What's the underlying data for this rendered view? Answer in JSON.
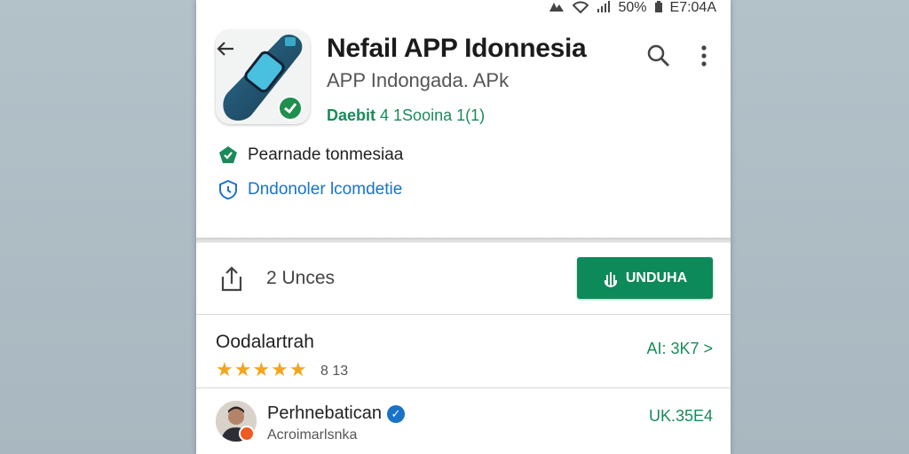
{
  "status_bar": {
    "battery": "50%",
    "time": "E7:04A"
  },
  "app": {
    "title": "Nefail APP Idonnesia",
    "subtitle": "APP Indongada. APk",
    "developer_name": "Daebit",
    "developer_rating": "4 1Sooina 1(1)"
  },
  "info": {
    "line1": "Pearnade tonmesiaa",
    "line2": "Dndonoler lcomdetie"
  },
  "install_row": {
    "units": "2 Unces",
    "install_label": "UNDUHA"
  },
  "rating_row": {
    "title": "Oodalartrah",
    "stars": "★★★★★",
    "count": "8 13",
    "value": "AI: 3K7 >"
  },
  "reviewer_row": {
    "name": "Perhnebatican",
    "sub": "Acroimarlsnka",
    "value": "UK.35E4"
  },
  "colors": {
    "accent_green": "#0d8a5a",
    "link_blue": "#1a73c8",
    "star_orange": "#f3a51b"
  }
}
